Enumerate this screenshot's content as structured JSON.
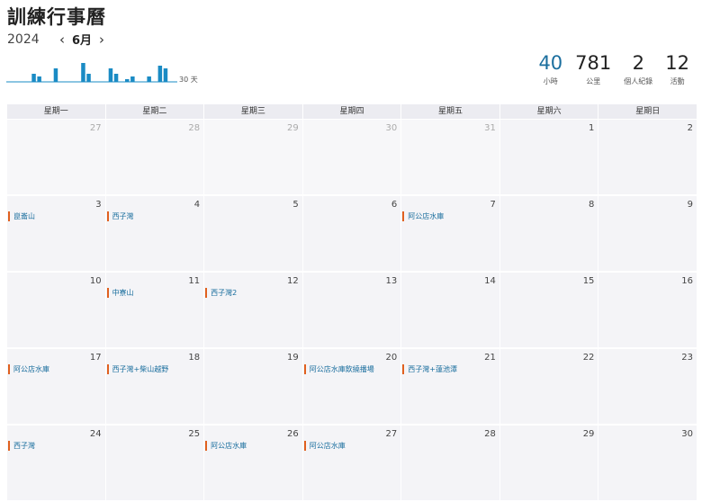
{
  "header": {
    "title": "訓練行事曆",
    "year": "2024",
    "month": "6月",
    "prev_icon": "chevron-left-icon",
    "next_icon": "chevron-right-icon"
  },
  "mini_chart": {
    "label": "30 天",
    "color": "#1a8bc4",
    "bars": [
      0,
      0,
      0,
      3,
      2,
      0,
      0,
      5,
      0,
      0,
      0,
      0,
      7,
      3,
      0,
      0,
      0,
      5,
      3,
      0,
      1,
      2,
      0,
      0,
      2,
      0,
      6,
      5,
      0,
      0
    ]
  },
  "stats": [
    {
      "value": "40",
      "label": "小時",
      "accent": true
    },
    {
      "value": "781",
      "label": "公里",
      "accent": false
    },
    {
      "value": "2",
      "label": "個人紀錄",
      "accent": false
    },
    {
      "value": "12",
      "label": "活動",
      "accent": false
    }
  ],
  "calendar": {
    "weekdays": [
      "星期一",
      "星期二",
      "星期三",
      "星期四",
      "星期五",
      "星期六",
      "星期日"
    ],
    "days": [
      {
        "day": "27",
        "out": true
      },
      {
        "day": "28",
        "out": true
      },
      {
        "day": "29",
        "out": true
      },
      {
        "day": "30",
        "out": true
      },
      {
        "day": "31",
        "out": true
      },
      {
        "day": "1"
      },
      {
        "day": "2"
      },
      {
        "day": "3",
        "event": "崑崙山"
      },
      {
        "day": "4",
        "event": "西子灣"
      },
      {
        "day": "5"
      },
      {
        "day": "6"
      },
      {
        "day": "7",
        "event": "阿公店水庫"
      },
      {
        "day": "8"
      },
      {
        "day": "9"
      },
      {
        "day": "10"
      },
      {
        "day": "11",
        "event": "中寮山"
      },
      {
        "day": "12",
        "event": "西子灣2"
      },
      {
        "day": "13"
      },
      {
        "day": "14"
      },
      {
        "day": "15"
      },
      {
        "day": "16"
      },
      {
        "day": "17",
        "event": "阿公店水庫"
      },
      {
        "day": "18",
        "event": "西子灣+柴山越野"
      },
      {
        "day": "19"
      },
      {
        "day": "20",
        "event": "阿公店水庫飲繞播場"
      },
      {
        "day": "21",
        "event": "西子灣+蓮池潭"
      },
      {
        "day": "22"
      },
      {
        "day": "23"
      },
      {
        "day": "24",
        "event": "西子灣"
      },
      {
        "day": "25"
      },
      {
        "day": "26",
        "event": "阿公店水庫"
      },
      {
        "day": "27",
        "event": "阿公店水庫"
      },
      {
        "day": "28"
      },
      {
        "day": "29"
      },
      {
        "day": "30"
      }
    ]
  },
  "colors": {
    "accent": "#1a6e9e",
    "event_marker": "#e0601f",
    "cell_bg": "#f4f4f7",
    "header_bg": "#ececf1"
  }
}
